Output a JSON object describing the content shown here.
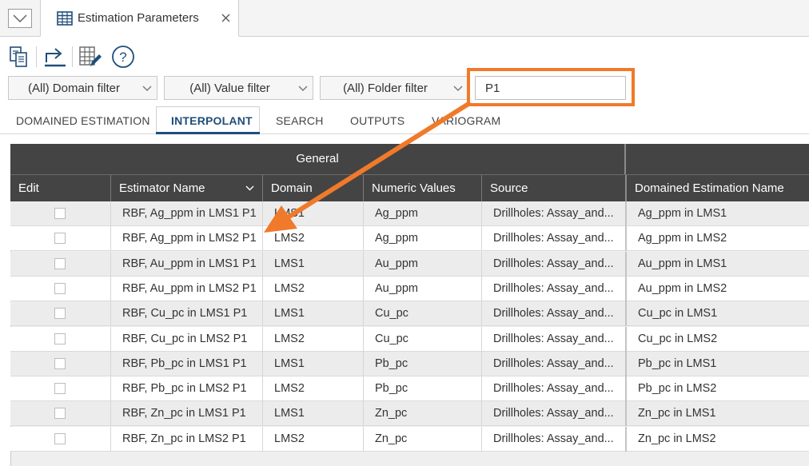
{
  "tab": {
    "title": "Estimation Parameters",
    "dropdown_icon": "chevron-down-icon",
    "close_icon": "close-icon",
    "tab_icon": "table-grid-icon"
  },
  "toolbar": {
    "buttons": [
      {
        "name": "copy-icon"
      },
      {
        "name": "export-icon"
      },
      {
        "name": "table-edit-icon"
      },
      {
        "name": "help-icon",
        "label": "?"
      }
    ]
  },
  "filters": {
    "domain": "(All) Domain filter",
    "value": "(All) Value filter",
    "folder": "(All) Folder filter",
    "search_value": "P1"
  },
  "subtabs": [
    "DOMAINED ESTIMATION",
    "INTERPOLANT",
    "SEARCH",
    "OUTPUTS",
    "VARIOGRAM"
  ],
  "active_subtab": "INTERPOLANT",
  "table": {
    "group_header": "General",
    "columns": [
      "Edit",
      "Estimator Name",
      "Domain",
      "Numeric Values",
      "Source",
      "Domained Estimation Name"
    ],
    "rows": [
      {
        "name": "RBF, Ag_ppm in LMS1 P1",
        "domain": "LMS1",
        "values": "Ag_ppm",
        "source": "Drillholes: Assay_and...",
        "den": "Ag_ppm in LMS1"
      },
      {
        "name": "RBF, Ag_ppm in LMS2 P1",
        "domain": "LMS2",
        "values": "Ag_ppm",
        "source": "Drillholes: Assay_and...",
        "den": "Ag_ppm in LMS2"
      },
      {
        "name": "RBF, Au_ppm in LMS1 P1",
        "domain": "LMS1",
        "values": "Au_ppm",
        "source": "Drillholes: Assay_and...",
        "den": "Au_ppm in LMS1"
      },
      {
        "name": "RBF, Au_ppm in LMS2 P1",
        "domain": "LMS2",
        "values": "Au_ppm",
        "source": "Drillholes: Assay_and...",
        "den": "Au_ppm in LMS2"
      },
      {
        "name": "RBF, Cu_pc in LMS1 P1",
        "domain": "LMS1",
        "values": "Cu_pc",
        "source": "Drillholes: Assay_and...",
        "den": "Cu_pc in LMS1"
      },
      {
        "name": "RBF, Cu_pc in LMS2 P1",
        "domain": "LMS2",
        "values": "Cu_pc",
        "source": "Drillholes: Assay_and...",
        "den": "Cu_pc in LMS2"
      },
      {
        "name": "RBF, Pb_pc in LMS1 P1",
        "domain": "LMS1",
        "values": "Pb_pc",
        "source": "Drillholes: Assay_and...",
        "den": "Pb_pc in LMS1"
      },
      {
        "name": "RBF, Pb_pc in LMS2 P1",
        "domain": "LMS2",
        "values": "Pb_pc",
        "source": "Drillholes: Assay_and...",
        "den": "Pb_pc in LMS2"
      },
      {
        "name": "RBF, Zn_pc in LMS1 P1",
        "domain": "LMS1",
        "values": "Zn_pc",
        "source": "Drillholes: Assay_and...",
        "den": "Zn_pc in LMS1"
      },
      {
        "name": "RBF, Zn_pc in LMS2 P1",
        "domain": "LMS2",
        "values": "Zn_pc",
        "source": "Drillholes: Assay_and...",
        "den": "Zn_pc in LMS2"
      }
    ]
  },
  "colors": {
    "highlight": "#f07a2a",
    "header_bg": "#444444",
    "active_tab": "#1f4e79"
  }
}
